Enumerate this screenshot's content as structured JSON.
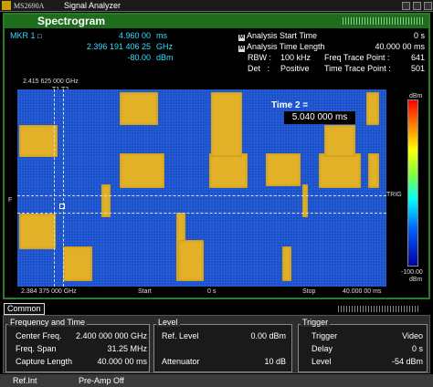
{
  "titlebar": {
    "model": "MS2690A",
    "app_title": "Signal Analyzer"
  },
  "main": {
    "title": "Spectrogram",
    "marker": {
      "label": "MKR 1",
      "time": "4.960 00",
      "time_unit": "ms",
      "freq": "2.396 191 406 25",
      "freq_unit": "GHz",
      "level": "-80.00",
      "level_unit": "dBm"
    },
    "params": {
      "analysis_start_label": "Analysis Start Time",
      "analysis_start_value": "0 s",
      "analysis_len_label": "Analysis Time Length",
      "analysis_len_value": "40.000 00 ms",
      "rbw_label": "RBW :",
      "rbw_value": "100 kHz",
      "ftp_label": "Freq Trace Point :",
      "ftp_value": "641",
      "det_label": "Det   :",
      "det_value": "Positive",
      "ttp_label": "Time Trace Point :",
      "ttp_value": "501"
    },
    "plot": {
      "top_freq": "2.415 625 000 GHz",
      "bottom_freq": "2.384 375 000 GHz",
      "t1_label": "T1",
      "t2_label": "T2",
      "time2_label": "Time 2 =",
      "time2_value": "5.040 000 ms",
      "f_label": "F",
      "trig_label": "TRIG",
      "start_label": "Start",
      "start_value": "0 s",
      "stop_label": "Stop",
      "stop_value": "40.000 00 ms",
      "scale_top_unit": "dBm",
      "scale_bottom_value": "-100.00",
      "scale_bottom_unit": "dBm",
      "colors": {
        "background": "#1b4fc8",
        "signal": "#e3b128"
      }
    }
  },
  "common": {
    "tab_label": "Common",
    "freq_time": {
      "title": "Frequency and Time",
      "center_label": "Center Freq.",
      "center_value": "2.400 000 000 GHz",
      "span_label": "Freq. Span",
      "span_value": "31.25 MHz",
      "capture_label": "Capture Length",
      "capture_value": "40.000 00 ms"
    },
    "level": {
      "title": "Level",
      "ref_label": "Ref. Level",
      "ref_value": "0.00 dBm",
      "att_label": "Attenuator",
      "att_value": "10 dB"
    },
    "trigger": {
      "title": "Trigger",
      "trig_label": "Trigger",
      "trig_value": "Video",
      "delay_label": "Delay",
      "delay_value": "0 s",
      "level_label": "Level",
      "level_value": "-54 dBm"
    }
  },
  "status": {
    "ref": "Ref.Int",
    "preamp": "Pre-Amp Off"
  }
}
